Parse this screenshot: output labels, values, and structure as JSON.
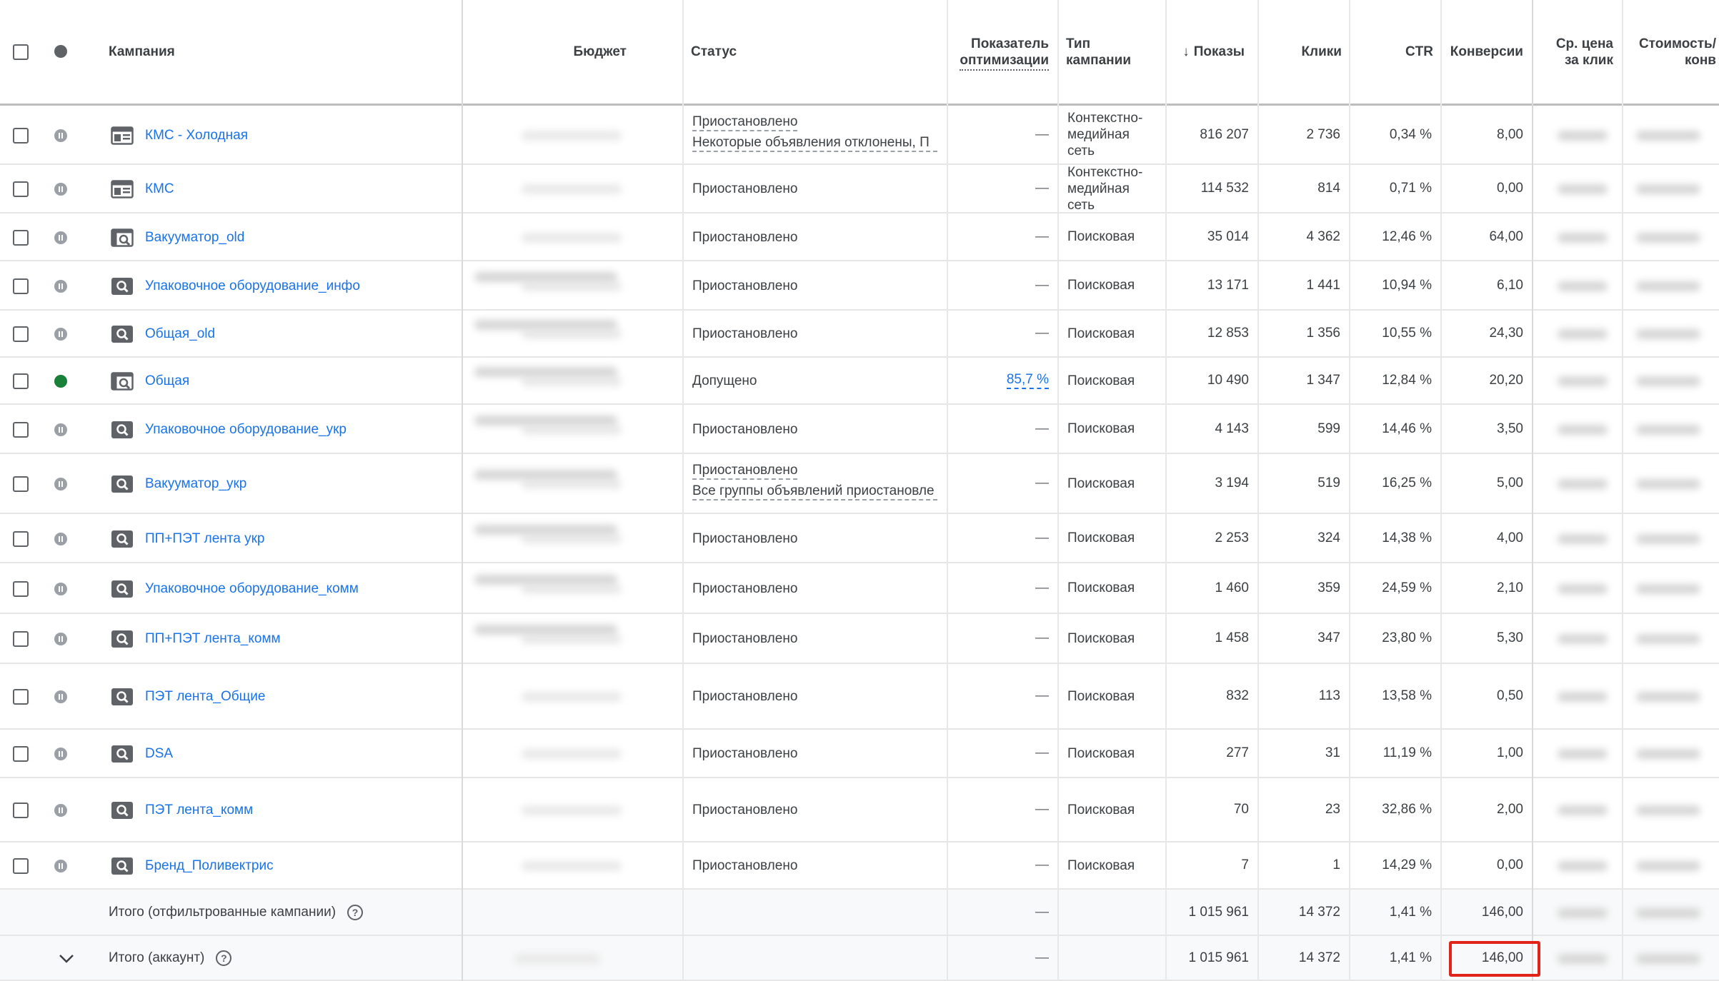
{
  "header": {
    "campaign": "Кампания",
    "budget": "Бюджет",
    "status": "Статус",
    "optimization_line1": "Показатель",
    "optimization_line2": "оптимизации",
    "type_line1": "Тип",
    "type_line2": "кампании",
    "sort_arrow": "↓",
    "impressions": "Показы",
    "clicks": "Клики",
    "ctr": "CTR",
    "conversions": "Конверсии",
    "avg_cpc_line1": "Ср. цена",
    "avg_cpc_line2": "за клик",
    "cost_conv_line1": "Стоимость/",
    "cost_conv_line2": "конв"
  },
  "rows": [
    {
      "name": "КМС - Холодная",
      "icon": "display-icon",
      "state": "paused",
      "status": "Приостановлено",
      "status_sub": "Некоторые объявления отклонены, П",
      "opt": "—",
      "type": [
        "Контекстно-",
        "медийная",
        "сеть"
      ],
      "impressions": "816 207",
      "clicks": "2 736",
      "ctr": "0,34 %",
      "conversions": "8,00"
    },
    {
      "name": "КМС",
      "icon": "display-icon",
      "state": "paused",
      "status": "Приостановлено",
      "status_sub": "",
      "opt": "—",
      "type": [
        "Контекстно-",
        "медийная",
        "сеть"
      ],
      "impressions": "114 532",
      "clicks": "814",
      "ctr": "0,71 %",
      "conversions": "0,00"
    },
    {
      "name": "Вакууматор_old",
      "icon": "smart-search-icon",
      "state": "paused",
      "status": "Приостановлено",
      "status_sub": "",
      "opt": "—",
      "type": [
        "Поисковая"
      ],
      "impressions": "35 014",
      "clicks": "4 362",
      "ctr": "12,46 %",
      "conversions": "64,00"
    },
    {
      "name": "Упаковочное оборудование_инфо",
      "icon": "search-icon",
      "state": "paused",
      "status": "Приостановлено",
      "status_sub": "",
      "opt": "—",
      "type": [
        "Поисковая"
      ],
      "impressions": "13 171",
      "clicks": "1 441",
      "ctr": "10,94 %",
      "conversions": "6,10"
    },
    {
      "name": "Общая_old",
      "icon": "search-icon",
      "state": "paused",
      "status": "Приостановлено",
      "status_sub": "",
      "opt": "—",
      "type": [
        "Поисковая"
      ],
      "impressions": "12 853",
      "clicks": "1 356",
      "ctr": "10,55 %",
      "conversions": "24,30"
    },
    {
      "name": "Общая",
      "icon": "smart-search-icon",
      "state": "active",
      "status": "Допущено",
      "status_sub": "",
      "opt": "85,7 %",
      "type": [
        "Поисковая"
      ],
      "impressions": "10 490",
      "clicks": "1 347",
      "ctr": "12,84 %",
      "conversions": "20,20"
    },
    {
      "name": "Упаковочное оборудование_укр",
      "icon": "search-icon",
      "state": "paused",
      "status": "Приостановлено",
      "status_sub": "",
      "opt": "—",
      "type": [
        "Поисковая"
      ],
      "impressions": "4 143",
      "clicks": "599",
      "ctr": "14,46 %",
      "conversions": "3,50"
    },
    {
      "name": "Вакууматор_укр",
      "icon": "search-icon",
      "state": "paused",
      "status": "Приостановлено",
      "status_sub": "Все группы объявлений приостановле",
      "opt": "—",
      "type": [
        "Поисковая"
      ],
      "impressions": "3 194",
      "clicks": "519",
      "ctr": "16,25 %",
      "conversions": "5,00"
    },
    {
      "name": "ПП+ПЭТ лента укр",
      "icon": "search-icon",
      "state": "paused",
      "status": "Приостановлено",
      "status_sub": "",
      "opt": "—",
      "type": [
        "Поисковая"
      ],
      "impressions": "2 253",
      "clicks": "324",
      "ctr": "14,38 %",
      "conversions": "4,00"
    },
    {
      "name": "Упаковочное оборудование_комм",
      "icon": "search-icon",
      "state": "paused",
      "status": "Приостановлено",
      "status_sub": "",
      "opt": "—",
      "type": [
        "Поисковая"
      ],
      "impressions": "1 460",
      "clicks": "359",
      "ctr": "24,59 %",
      "conversions": "2,10"
    },
    {
      "name": "ПП+ПЭТ лента_комм",
      "icon": "search-icon",
      "state": "paused",
      "status": "Приостановлено",
      "status_sub": "",
      "opt": "—",
      "type": [
        "Поисковая"
      ],
      "impressions": "1 458",
      "clicks": "347",
      "ctr": "23,80 %",
      "conversions": "5,30"
    },
    {
      "name": "ПЭТ лента_Общие",
      "icon": "search-icon",
      "state": "paused",
      "status": "Приостановлено",
      "status_sub": "",
      "opt": "—",
      "type": [
        "Поисковая"
      ],
      "impressions": "832",
      "clicks": "113",
      "ctr": "13,58 %",
      "conversions": "0,50"
    },
    {
      "name": "DSA",
      "icon": "search-icon",
      "state": "paused",
      "status": "Приостановлено",
      "status_sub": "",
      "opt": "—",
      "type": [
        "Поисковая"
      ],
      "impressions": "277",
      "clicks": "31",
      "ctr": "11,19 %",
      "conversions": "1,00"
    },
    {
      "name": "ПЭТ лента_комм",
      "icon": "search-icon",
      "state": "paused",
      "status": "Приостановлено",
      "status_sub": "",
      "opt": "—",
      "type": [
        "Поисковая"
      ],
      "impressions": "70",
      "clicks": "23",
      "ctr": "32,86 %",
      "conversions": "2,00"
    },
    {
      "name": "Бренд_Поливектрис",
      "icon": "search-icon",
      "state": "paused",
      "status": "Приостановлено",
      "status_sub": "",
      "opt": "—",
      "type": [
        "Поисковая"
      ],
      "impressions": "7",
      "clicks": "1",
      "ctr": "14,29 %",
      "conversions": "0,00"
    }
  ],
  "totals": [
    {
      "label": "Итого (отфильтрованные кампании)",
      "opt": "—",
      "impressions": "1 015 961",
      "clicks": "14 372",
      "ctr": "1,41 %",
      "conversions": "146,00"
    },
    {
      "label": "Итого (аккаунт)",
      "opt": "—",
      "impressions": "1 015 961",
      "clicks": "14 372",
      "ctr": "1,41 %",
      "conversions": "146,00"
    }
  ],
  "help_glyph": "?",
  "colors": {
    "link": "#1a73e8",
    "active": "#188038",
    "paused": "#9aa0a6",
    "highlight": "#e2231a"
  }
}
